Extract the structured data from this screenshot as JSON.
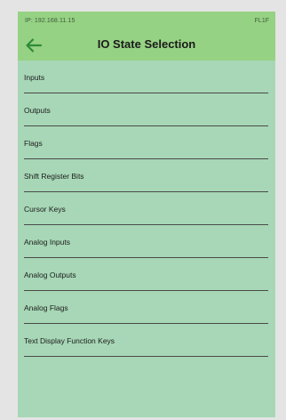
{
  "status": {
    "ip": "IP: 192.168.11.15",
    "device_id": "FL1F"
  },
  "header": {
    "title": "IO State Selection",
    "back_icon": "arrow-left-icon"
  },
  "colors": {
    "header_bg": "#96d283",
    "body_bg": "#a7d7b6",
    "back_arrow": "#2e8b3a"
  },
  "menu": {
    "items": [
      {
        "label": "Inputs"
      },
      {
        "label": "Outputs"
      },
      {
        "label": "Flags"
      },
      {
        "label": "Shift Register Bits"
      },
      {
        "label": "Cursor Keys"
      },
      {
        "label": "Analog Inputs"
      },
      {
        "label": "Analog Outputs"
      },
      {
        "label": "Analog Flags"
      },
      {
        "label": "Text Display Function Keys"
      }
    ]
  }
}
